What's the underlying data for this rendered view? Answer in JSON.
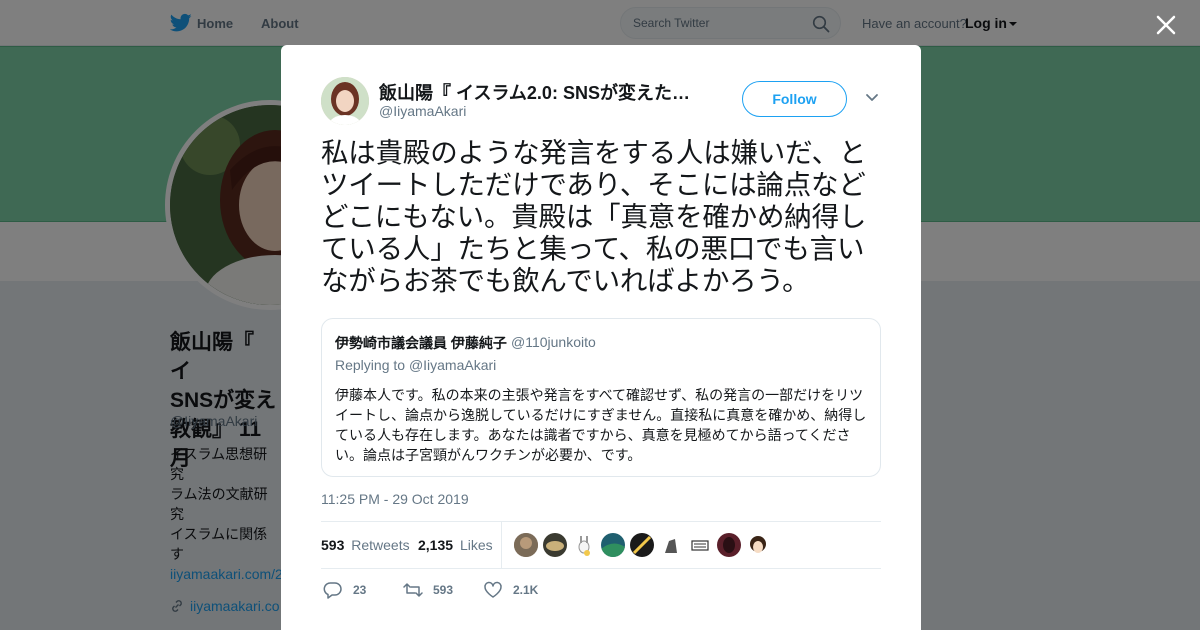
{
  "header": {
    "home_label": "Home",
    "about_label": "About",
    "search_placeholder": "Search Twitter",
    "have_account": "Have an account?",
    "login_label": "Log in"
  },
  "profile": {
    "name": "飯山陽『 イ\nSNSが変え\n教観』 11月",
    "handle": "@IiyamaAkari",
    "bio": "イスラム思想研究\nラム法の文献研究\nイスラムに関係す\nニタリング、リサ\nも生業としていま\nはこちら→",
    "bio_link": "iiyamaakari.com/2",
    "website": "iiyamaakari.co"
  },
  "tweet": {
    "author_name": "飯山陽『 イスラム2.0: SNSが変えた…",
    "author_handle": "@IiyamaAkari",
    "follow_label": "Follow",
    "text": "私は貴殿のような発言をする人は嫌いだ、とツイートしただけであり、そこには論点などどこにもない。貴殿は「真意を確かめ納得している人」たちと集って、私の悪口でも言いながらお茶でも飲んでいればよかろう。",
    "timestamp": "11:25 PM - 29 Oct 2019",
    "retweets_count": "593",
    "retweets_label": "Retweets",
    "likes_count": "2,135",
    "likes_label": "Likes",
    "reply_count": "23",
    "retweet_count_action": "593",
    "like_count_action": "2.1K"
  },
  "quoted_tweet": {
    "author_name": "伊勢崎市議会議員 伊藤純子",
    "author_handle": "@110junkoito",
    "replying_to_label": "Replying to",
    "replying_to_handle": "@IiyamaAkari",
    "text": "伊藤本人です。私の本来の主張や発言をすべて確認せず、私の発言の一部だけをリツイートし、論点から逸脱しているだけにすぎません。直接私に真意を確かめ、納得している人も存在します。あなたは識者ですから、真意を見極めてから語ってください。論点は子宮頸がんワクチンが必要か、です。"
  },
  "colors": {
    "accent": "#1da1f2",
    "banner": "#7fd3a8",
    "muted_text": "#657786",
    "divider": "#e6ecf0"
  },
  "icons": [
    "twitter-bird-icon",
    "search-icon",
    "close-icon",
    "chevron-down-icon",
    "reply-icon",
    "retweet-icon",
    "heart-icon",
    "link-icon"
  ]
}
